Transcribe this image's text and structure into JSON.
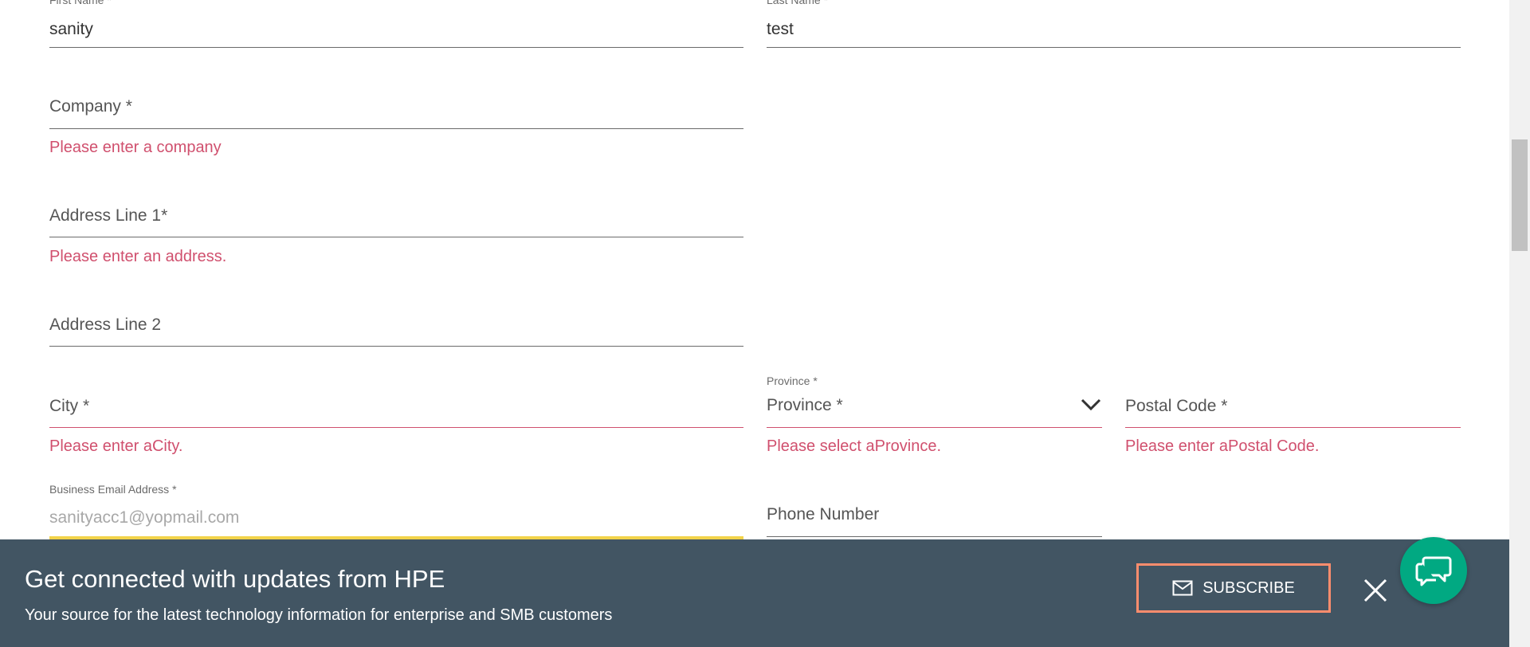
{
  "form": {
    "first_name": {
      "label": "First Name *",
      "value": "sanity"
    },
    "last_name": {
      "label": "Last Name *",
      "value": "test"
    },
    "company": {
      "placeholder": "Company *",
      "error": "Please enter a company"
    },
    "address1": {
      "placeholder": "Address Line 1*",
      "error": "Please enter an address."
    },
    "address2": {
      "placeholder": "Address Line 2"
    },
    "city": {
      "placeholder": "City *",
      "error": "Please enter aCity."
    },
    "province": {
      "label": "Province *",
      "selected": "Province *",
      "error": "Please select aProvince."
    },
    "postal_code": {
      "placeholder": "Postal Code *",
      "error": "Please enter aPostal Code."
    },
    "email": {
      "label": "Business Email Address *",
      "value": "sanityacc1@yopmail.com"
    },
    "phone": {
      "placeholder": "Phone Number"
    }
  },
  "banner": {
    "title": "Get connected with updates from HPE",
    "subtitle": "Your source for the latest technology information for enterprise and SMB customers",
    "subscribe_label": "SUBSCRIBE",
    "icons": {
      "mail": "mail-icon",
      "close": "close-icon",
      "chat": "chat-icon"
    }
  },
  "colors": {
    "error": "#d0506e",
    "banner_bg": "#425563",
    "subscribe_border": "#ff8d6d",
    "chat_bg": "#01a982",
    "focus_underline": "#f2d34a"
  }
}
